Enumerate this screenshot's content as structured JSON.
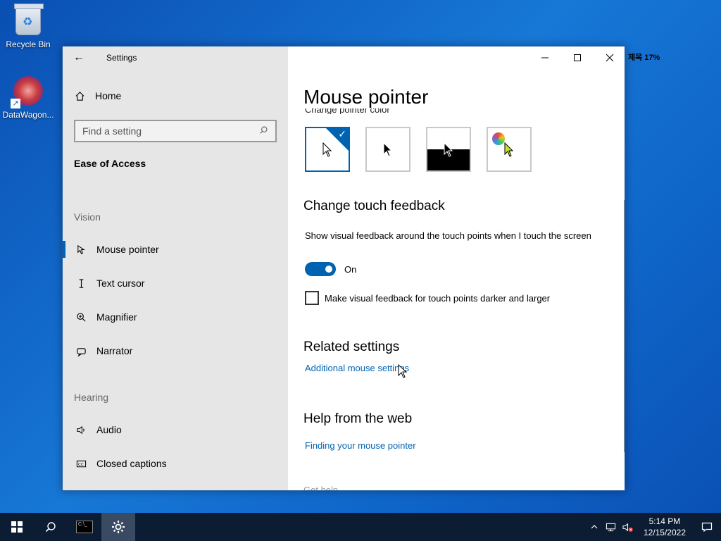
{
  "desktop": {
    "icons": [
      {
        "label": "Recycle Bin",
        "icon": "recycle-bin-icon"
      },
      {
        "label": "DataWagon...",
        "icon": "datawagon-shortcut-icon"
      }
    ],
    "stray_text": "제목 17%"
  },
  "window": {
    "title": "Settings",
    "back_icon": "back-arrow-icon",
    "controls": [
      "minimize-icon",
      "maximize-icon",
      "close-icon"
    ]
  },
  "sidebar": {
    "home_label": "Home",
    "search_placeholder": "Find a setting",
    "section_title": "Ease of Access",
    "groups": {
      "vision": "Vision",
      "hearing": "Hearing"
    },
    "items": [
      {
        "label": "Mouse pointer",
        "icon": "mouse-pointer-icon",
        "active": true
      },
      {
        "label": "Text cursor",
        "icon": "text-cursor-icon",
        "active": false
      },
      {
        "label": "Magnifier",
        "icon": "magnifier-icon",
        "active": false
      },
      {
        "label": "Narrator",
        "icon": "narrator-icon",
        "active": false
      },
      {
        "label": "Audio",
        "icon": "audio-icon",
        "active": false
      },
      {
        "label": "Closed captions",
        "icon": "closed-captions-icon",
        "active": false
      }
    ]
  },
  "content": {
    "page_title": "Mouse pointer",
    "cut_label": "Change pointer color",
    "swatches": [
      "white",
      "black",
      "inverted",
      "custom"
    ],
    "touch_feedback": {
      "heading": "Change touch feedback",
      "description": "Show visual feedback around the touch points when I touch the screen",
      "toggle_label": "On",
      "toggle_on": true,
      "checkbox_label": "Make visual feedback for touch points darker and larger",
      "checkbox_checked": false
    },
    "related": {
      "heading": "Related settings",
      "link": "Additional mouse settings"
    },
    "help": {
      "heading": "Help from the web",
      "link": "Finding your mouse pointer",
      "faded_item": "Get help"
    }
  },
  "taskbar": {
    "time": "5:14 PM",
    "date": "12/15/2022"
  },
  "colors": {
    "accent": "#0063b1",
    "sidebar_bg": "#e6e6e6",
    "taskbar_bg": "#0b1c33"
  }
}
